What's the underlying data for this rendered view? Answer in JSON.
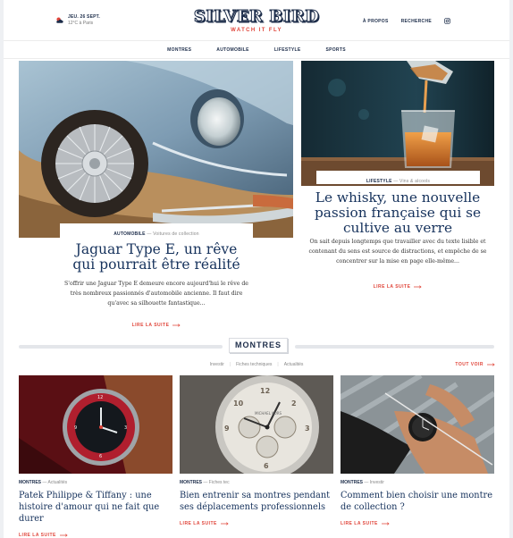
{
  "header": {
    "weather_date": "JEU. 26 SEPT.",
    "weather_temp": "12°C à Paris",
    "logo": "SILVER BIRD",
    "tagline": "WATCH IT FLY",
    "links": [
      "À PROPOS",
      "RECHERCHE"
    ],
    "icons": {
      "weather": "cloud-sun-icon",
      "social": "instagram-icon"
    }
  },
  "nav": [
    "MONTRES",
    "AUTOMOBILE",
    "LIFESTYLE",
    "SPORTS"
  ],
  "hero_main": {
    "category": "AUTOMOBILE",
    "subcategory": "— Voitures de collection",
    "title": "Jaguar Type E, un rêve qui pourrait être réalité",
    "excerpt": "S'offrir une Jaguar Type E demeure encore aujourd'hui le rêve de très nombreux passionnés d'automobile ancienne. Il faut dire qu'avec sa silhouette fantastique...",
    "read_more": "LIRE LA SUITE"
  },
  "hero_side": {
    "category": "LIFESTYLE",
    "subcategory": "— Vins & alcools",
    "title": "Le whisky, une nouvelle passion française qui se cultive au verre",
    "excerpt": "On sait depuis longtemps que travailler avec du texte lisible et contenant du sens est source de distractions, et empêche de se concentrer sur la mise en page elle-même...",
    "read_more": "LIRE LA SUITE"
  },
  "section": {
    "title": "MONTRES",
    "filters": [
      "Investir",
      "Fiches techniques",
      "Actualités"
    ],
    "see_all": "TOUT VOIR"
  },
  "cards": [
    {
      "category": "MONTRES",
      "subcategory": "— Actualités",
      "title": "Patek Philippe & Tiffany : une histoire d'amour qui ne fait que durer",
      "read_more": "LIRE LA SUITE"
    },
    {
      "category": "MONTRES",
      "subcategory": "— Fiches tec",
      "title": "Bien entrenir sa montres pendant ses déplacements professionnels",
      "read_more": "LIRE LA SUITE"
    },
    {
      "category": "MONTRES",
      "subcategory": "— Investir",
      "title": "Comment bien choisir une montre de collection ?",
      "read_more": "LIRE LA SUITE"
    }
  ],
  "colors": {
    "accent": "#e0453a",
    "navy": "#1d2d4a",
    "title_blue": "#16325c"
  }
}
